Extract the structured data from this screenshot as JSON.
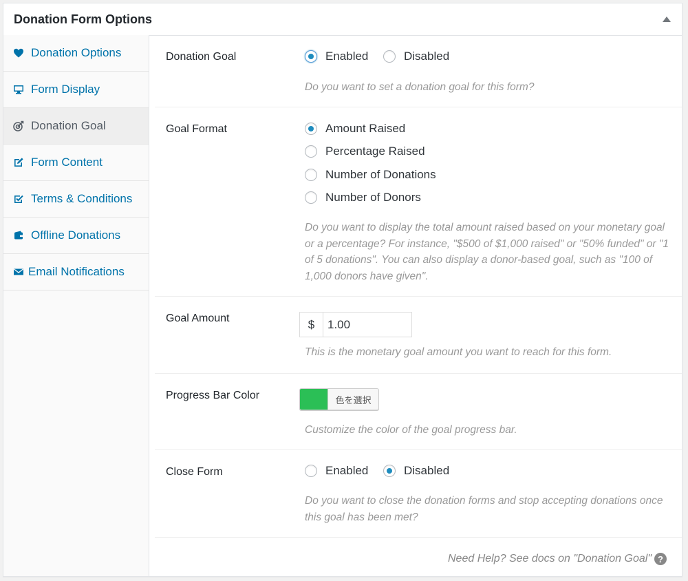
{
  "panel": {
    "title": "Donation Form Options"
  },
  "sidebar": {
    "items": [
      {
        "label": "Donation Options",
        "icon": "heart-icon"
      },
      {
        "label": "Form Display",
        "icon": "monitor-icon"
      },
      {
        "label": "Donation Goal",
        "icon": "target-icon"
      },
      {
        "label": "Form Content",
        "icon": "edit-icon"
      },
      {
        "label": "Terms & Conditions",
        "icon": "checkbox-icon"
      },
      {
        "label": "Offline Donations",
        "icon": "wallet-icon"
      },
      {
        "label": "Email Notifications",
        "icon": "envelope-icon"
      }
    ]
  },
  "donation_goal": {
    "label": "Donation Goal",
    "options": [
      "Enabled",
      "Disabled"
    ],
    "selected": "Enabled",
    "description": "Do you want to set a donation goal for this form?"
  },
  "goal_format": {
    "label": "Goal Format",
    "options": [
      "Amount Raised",
      "Percentage Raised",
      "Number of Donations",
      "Number of Donors"
    ],
    "selected": "Amount Raised",
    "description": "Do you want to display the total amount raised based on your monetary goal or a percentage? For instance, \"$500 of $1,000 raised\" or \"50% funded\" or \"1 of 5 donations\". You can also display a donor-based goal, such as \"100 of 1,000 donors have given\"."
  },
  "goal_amount": {
    "label": "Goal Amount",
    "currency": "$",
    "value": "1.00",
    "description": "This is the monetary goal amount you want to reach for this form."
  },
  "progress_bar_color": {
    "label": "Progress Bar Color",
    "color": "#2bbf56",
    "button_label": "色を選択",
    "description": "Customize the color of the goal progress bar."
  },
  "close_form": {
    "label": "Close Form",
    "options": [
      "Enabled",
      "Disabled"
    ],
    "selected": "Disabled",
    "description": "Do you want to close the donation forms and stop accepting donations once this goal has been met?"
  },
  "help": {
    "text": "Need Help? See docs on \"Donation Goal\""
  },
  "colors": {
    "link": "#0073aa",
    "radio": "#1e8cbe",
    "active_bg": "#eeeeee"
  }
}
